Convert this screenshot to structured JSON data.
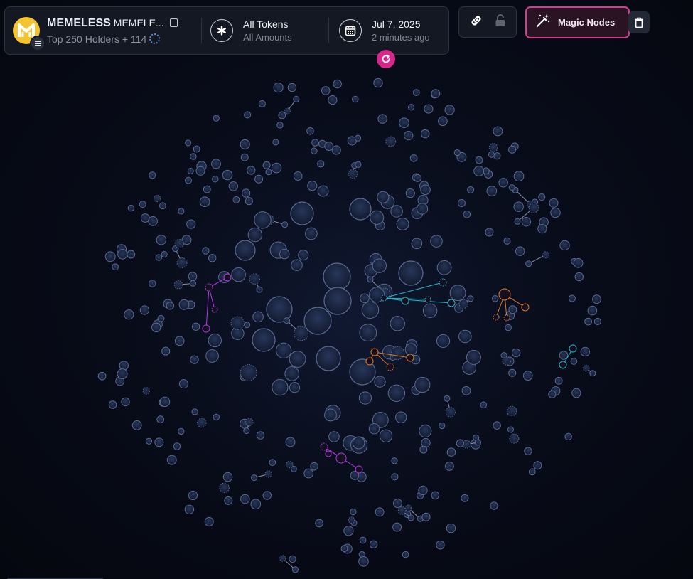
{
  "token": {
    "name": "MEMELESS",
    "symbol": "MEMELE...",
    "subtitle": "Top 250 Holders + 114",
    "logo_letter": "M",
    "logo_color": "#f4c430",
    "chain_icon": "chain-icon"
  },
  "filter": {
    "title": "All Tokens",
    "subtitle": "All Amounts"
  },
  "date": {
    "value": "Jul 7, 2025",
    "relative": "2 minutes ago"
  },
  "toolbar": {
    "magic_label": "Magic Nodes"
  },
  "colors": {
    "accent": "#d63d92",
    "refresh": "#d7288a",
    "node_default": "#1c2741",
    "node_stroke": "#5a6b95",
    "cluster_purple": "#b03de0",
    "cluster_teal": "#2fb4c9",
    "cluster_orange": "#e07a2a"
  },
  "icons": [
    "copy-icon",
    "loading-spinner-icon",
    "asterisk-icon",
    "calendar-icon",
    "refresh-icon",
    "link-icon",
    "lock-icon",
    "magic-wand-icon",
    "trash-icon"
  ]
}
